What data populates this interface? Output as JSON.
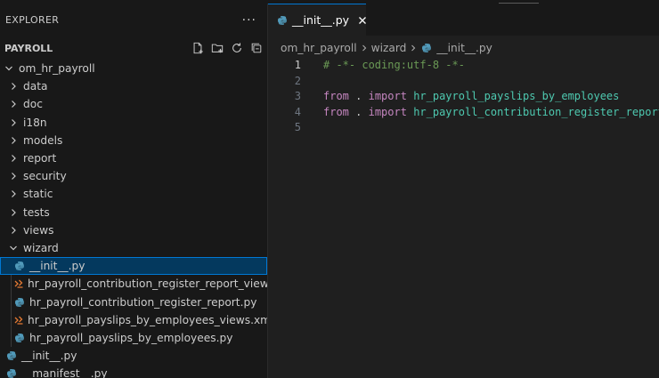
{
  "explorer": {
    "title": "EXPLORER",
    "more_label": "···",
    "section_title": "PAYROLL",
    "actions": [
      "new-file-icon",
      "new-folder-icon",
      "refresh-icon",
      "collapse-all-icon"
    ]
  },
  "tree": {
    "root": "om_hr_payroll",
    "folders": [
      "data",
      "doc",
      "i18n",
      "models",
      "report",
      "security",
      "static",
      "tests",
      "views"
    ],
    "open_folder": "wizard",
    "wizard_files": [
      {
        "name": "__init__.py",
        "type": "python",
        "selected": true
      },
      {
        "name": "hr_payroll_contribution_register_report_views.xml",
        "type": "xml"
      },
      {
        "name": "hr_payroll_contribution_register_report.py",
        "type": "python"
      },
      {
        "name": "hr_payroll_payslips_by_employees_views.xml",
        "type": "xml"
      },
      {
        "name": "hr_payroll_payslips_by_employees.py",
        "type": "python"
      }
    ],
    "root_files": [
      {
        "name": "__init__.py",
        "type": "python"
      },
      {
        "name": "__manifest__.py",
        "type": "python"
      }
    ]
  },
  "tab": {
    "label": "__init__.py"
  },
  "breadcrumb": [
    "om_hr_payroll",
    "wizard",
    "__init__.py"
  ],
  "editor": {
    "active_line": 1,
    "lines": [
      {
        "num": "1",
        "tokens": [
          {
            "t": "comment",
            "v": "# -*- coding:utf-8 -*-"
          }
        ]
      },
      {
        "num": "2",
        "tokens": []
      },
      {
        "num": "3",
        "tokens": [
          {
            "t": "kw",
            "v": "from"
          },
          {
            "t": "plain",
            "v": " . "
          },
          {
            "t": "kw",
            "v": "import"
          },
          {
            "t": "plain",
            "v": " "
          },
          {
            "t": "mod",
            "v": "hr_payroll_payslips_by_employees"
          }
        ]
      },
      {
        "num": "4",
        "tokens": [
          {
            "t": "kw",
            "v": "from"
          },
          {
            "t": "plain",
            "v": " . "
          },
          {
            "t": "kw",
            "v": "import"
          },
          {
            "t": "plain",
            "v": " "
          },
          {
            "t": "mod",
            "v": "hr_payroll_contribution_register_report"
          }
        ]
      },
      {
        "num": "5",
        "tokens": []
      }
    ]
  },
  "colors": {
    "accent": "#0078d4",
    "python_icon": "#519aba",
    "xml_icon": "#e37933"
  }
}
